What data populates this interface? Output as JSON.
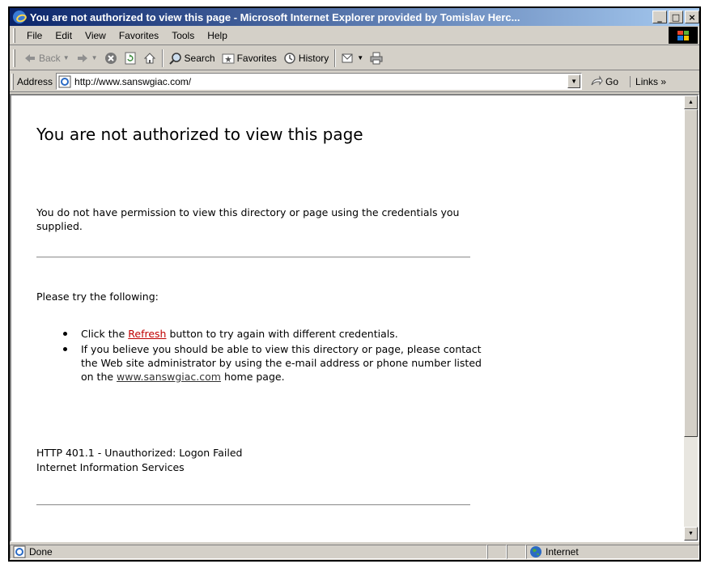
{
  "window": {
    "title": "You are not authorized to view this page - Microsoft Internet Explorer provided by Tomislav Herc...",
    "min_label": "_",
    "max_label": "□",
    "close_label": "×"
  },
  "menu": [
    "File",
    "Edit",
    "View",
    "Favorites",
    "Tools",
    "Help"
  ],
  "toolbar": {
    "back_label": "Back",
    "search_label": "Search",
    "favorites_label": "Favorites",
    "history_label": "History"
  },
  "address": {
    "label": "Address",
    "url": "http://www.sanswgiac.com/",
    "go_label": "Go",
    "links_label": "Links »"
  },
  "page": {
    "heading": "You are not authorized to view this page",
    "intro": "You do not have permission to view this directory or page using the credentials you supplied.",
    "try_label": "Please try the following:",
    "bullet1_pre": "Click the ",
    "bullet1_link": "Refresh",
    "bullet1_post": " button to try again with different credentials.",
    "bullet2_pre": "If you believe you should be able to view this directory or page, please contact the Web site administrator by using the e-mail address or phone number listed on the ",
    "bullet2_link": "www.sanswgiac.com",
    "bullet2_post": " home page.",
    "error_code": "HTTP 401.1 - Unauthorized: Logon Failed",
    "server": "Internet Information Services"
  },
  "status": {
    "text": "Done",
    "zone": "Internet"
  },
  "colors": {
    "titlebar_start": "#0a246a",
    "titlebar_end": "#a6caf0",
    "chrome": "#d4d0c8",
    "link_refresh": "#c00000"
  }
}
